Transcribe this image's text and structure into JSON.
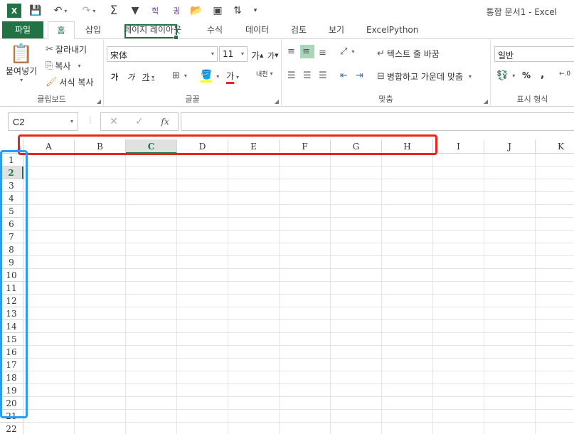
{
  "window": {
    "title": "통합 문서1 - Excel"
  },
  "tabs": [
    {
      "label": "파일"
    },
    {
      "label": "홈"
    },
    {
      "label": "삽입"
    },
    {
      "label": "페이지 레이아웃"
    },
    {
      "label": "수식"
    },
    {
      "label": "데이터"
    },
    {
      "label": "검토"
    },
    {
      "label": "보기"
    },
    {
      "label": "ExcelPython"
    }
  ],
  "ribbon": {
    "clipboard": {
      "paste": "붙여넣기",
      "cut": "잘라내기",
      "copy": "복사",
      "format_painter": "서식 복사",
      "label": "클립보드"
    },
    "font": {
      "name": "宋体",
      "size": "11",
      "increase": "가",
      "decrease": "가",
      "bold": "가",
      "italic": "가",
      "underline": "가",
      "font_color": "가",
      "phonetic": "내천",
      "label": "글꼴"
    },
    "alignment": {
      "wrap": "텍스트 줄 바꿈",
      "merge": "병합하고 가운데 맞춤",
      "label": "맞춤"
    },
    "number": {
      "format": "일반",
      "percent": "%",
      "comma": ",",
      "label": "표시 형식"
    }
  },
  "formula_bar": {
    "name_box": "C2",
    "cancel": "✕",
    "enter": "✓",
    "fx": "fx",
    "value": ""
  },
  "sheet": {
    "columns": [
      "A",
      "B",
      "C",
      "D",
      "E",
      "F",
      "G",
      "H",
      "I",
      "J",
      "K"
    ],
    "rows": [
      "1",
      "2",
      "3",
      "4",
      "5",
      "6",
      "7",
      "8",
      "9",
      "10",
      "11",
      "12",
      "13",
      "14",
      "15",
      "16",
      "17",
      "18",
      "19",
      "20",
      "21",
      "22"
    ],
    "active_column": "C",
    "active_row": "2"
  },
  "colors": {
    "accent": "#217346",
    "red_annotation": "#e8261c",
    "blue_annotation": "#2d9bf0"
  }
}
